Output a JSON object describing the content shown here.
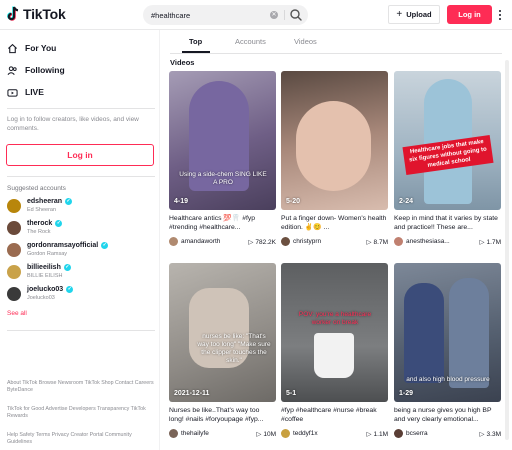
{
  "header": {
    "logo_text": "TikTok",
    "search_value": "#healthcare",
    "upload_label": "Upload",
    "login_label": "Log in"
  },
  "sidebar": {
    "nav": [
      {
        "label": "For You",
        "icon": "home-icon"
      },
      {
        "label": "Following",
        "icon": "following-icon"
      },
      {
        "label": "LIVE",
        "icon": "live-icon"
      }
    ],
    "login_hint": "Log in to follow creators, like videos, and view comments.",
    "login_label": "Log in",
    "suggested_title": "Suggested accounts",
    "accounts": [
      {
        "handle": "edsheeran",
        "name": "Ed Sheeran",
        "color": "#b8860b"
      },
      {
        "handle": "therock",
        "name": "The Rock",
        "color": "#6b4a3a"
      },
      {
        "handle": "gordonramsayofficial",
        "name": "Gordon Ramsay",
        "color": "#9a6b50"
      },
      {
        "handle": "billieeilish",
        "name": "BILLIE EILISH",
        "color": "#c9a24a"
      },
      {
        "handle": "joelucko03",
        "name": "Joelucko03",
        "color": "#3a3a3a"
      }
    ],
    "see_all": "See all",
    "footer": {
      "line1": "About TikTok Browse Newsroom TikTok Shop Contact Careers ByteDance",
      "line2": "TikTok for Good Advertise Developers Transparency TikTok Rewards",
      "line3": "Help Safety Terms Privacy Creator Portal Community Guidelines"
    }
  },
  "tabs": [
    "Top",
    "Accounts",
    "Videos"
  ],
  "section_title": "Videos",
  "videos": [
    {
      "overlay": "4-19",
      "caption": "Healthcare antics 💯🦷 #fyp #trending #healthcare...",
      "user": "amandaworth",
      "likes": "782.2K",
      "thumb_text": "Using a side-chem SING LIKE A PRO",
      "bg": "#7a6a8a"
    },
    {
      "overlay": "5-20",
      "caption": "Put a finger down- Women's health edition. ✌️😊 ...",
      "user": "christyprn",
      "likes": "8.7M",
      "thumb_text": "",
      "bg": "#8c6f60"
    },
    {
      "overlay": "2-24",
      "caption": "Keep in mind that it varies by state and practice!! These are...",
      "user": "anesthesiasa...",
      "likes": "1.7M",
      "thumb_text": "Healthcare jobs that make six figures without going to medical school",
      "bg": "#9fb3c2"
    },
    {
      "overlay": "2021-12-11",
      "caption": "Nurses be like..That's way too long! #nails #foryoupage #fyp...",
      "user": "thehailyfe",
      "likes": "10M",
      "thumb_text": "nurses be like: \"That's way too long\" \"Make sure the clipper touches the skin.\"",
      "bg": "#9d9a96"
    },
    {
      "overlay": "5-1",
      "caption": "#fyp #healthcare #nurse #break #coffee",
      "user": "teddyf1x",
      "likes": "1.1M",
      "thumb_text": "POV: you're a healthcare worker on break",
      "bg": "#6e6f70"
    },
    {
      "overlay": "1-29",
      "caption": "being a nurse gives you high BP and very clearly emotional...",
      "user": "bcserra",
      "likes": "3.3M",
      "thumb_text": "and also high blood pressure",
      "bg": "#556070"
    }
  ]
}
